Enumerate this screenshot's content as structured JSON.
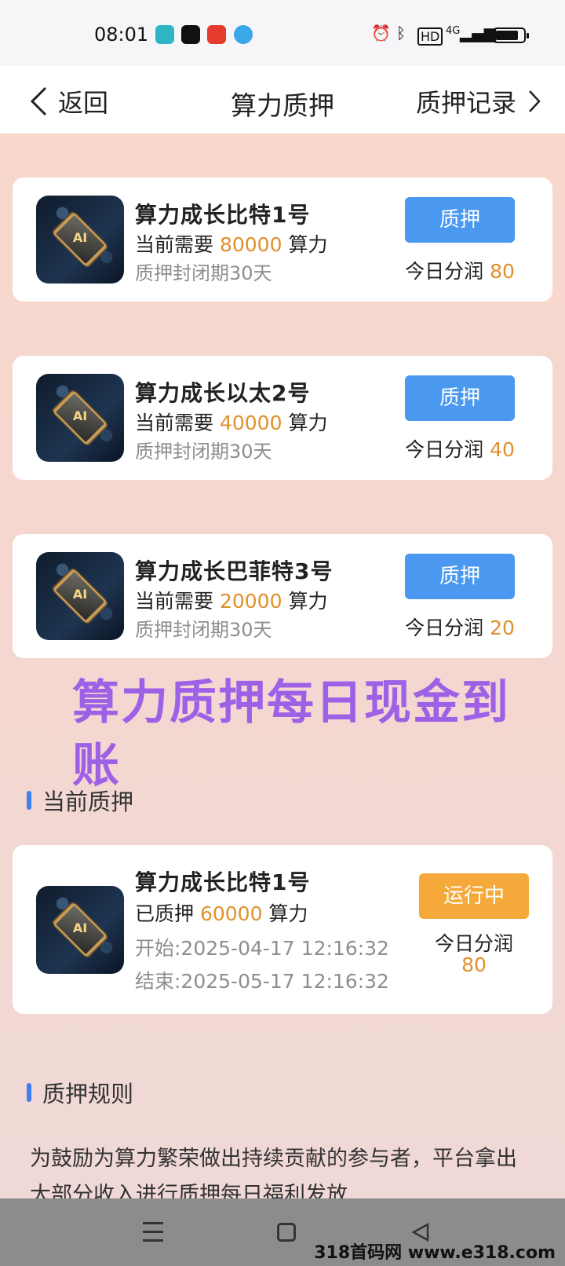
{
  "status_bar": {
    "time": "08:01",
    "network": "4G",
    "hd_label": "HD"
  },
  "header": {
    "back_label": "返回",
    "title": "算力质押",
    "record_label": "质押记录"
  },
  "plans": [
    {
      "chip_label": "AI",
      "name": "算力成长比特1号",
      "need_prefix": "当前需要",
      "need_value": "80000",
      "need_unit": "算力",
      "lock": "质押封闭期30天",
      "button": "质押",
      "daily_label": "今日分润",
      "daily_value": "80"
    },
    {
      "chip_label": "AI",
      "name": "算力成长以太2号",
      "need_prefix": "当前需要",
      "need_value": "40000",
      "need_unit": "算力",
      "lock": "质押封闭期30天",
      "button": "质押",
      "daily_label": "今日分润",
      "daily_value": "40"
    },
    {
      "chip_label": "AI",
      "name": "算力成长巴菲特3号",
      "need_prefix": "当前需要",
      "need_value": "20000",
      "need_unit": "算力",
      "lock": "质押封闭期30天",
      "button": "质押",
      "daily_label": "今日分润",
      "daily_value": "20"
    }
  ],
  "promo_text": "算力质押每日现金到账",
  "current_section": {
    "title": "当前质押",
    "item": {
      "chip_label": "AI",
      "name": "算力成长比特1号",
      "pledged_prefix": "已质押",
      "pledged_value": "60000",
      "pledged_unit": "算力",
      "start": "开始:2025-04-17 12:16:32",
      "end": "结束:2025-05-17 12:16:32",
      "status": "运行中",
      "daily_label": "今日分润",
      "daily_value": "80"
    }
  },
  "rules_section": {
    "title": "质押规则",
    "text": "为鼓励为算力繁荣做出持续贡献的参与者，平台拿出大部分收入进行质押每日福利发放"
  },
  "watermark": "318首码网 www.e318.com",
  "colors": {
    "accent_blue": "#4a98ef",
    "accent_orange": "#e0902a",
    "running_orange": "#f5a93a",
    "promo_purple": "#9a5be8"
  }
}
